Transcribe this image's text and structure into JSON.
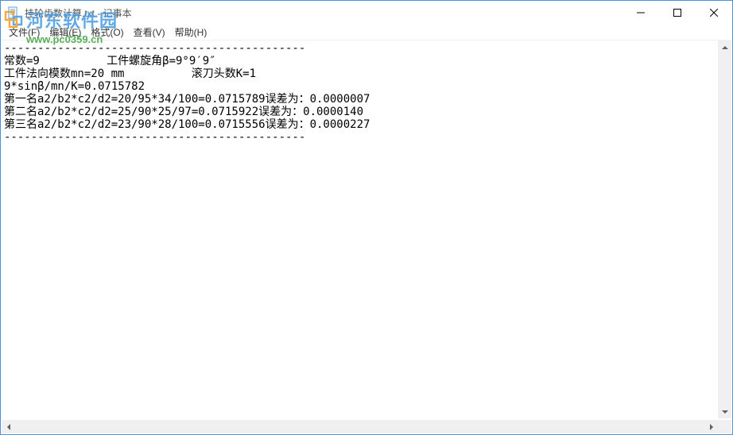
{
  "window": {
    "title": "挂轮齿数计算.txt - 记事本"
  },
  "menu": {
    "file": "文件(F)",
    "edit": "编辑(E)",
    "format": "格式(O)",
    "view": "查看(V)",
    "help": "帮助(H)"
  },
  "controls": {
    "minimize": "—",
    "maximize": "☐",
    "close": "✕"
  },
  "document": {
    "text": "---------------------------------------------\n常数=9          工件螺旋角β=9°9′9″\n工件法向模数mn=20 mm          滚刀头数K=1\n9*sinβ/mn/K=0.0715782\n第一名a2/b2*c2/d2=20/95*34/100=0.0715789误差为：0.0000007\n第二名a2/b2*c2/d2=25/90*25/97=0.0715922误差为：0.0000140\n第三名a2/b2*c2/d2=23/90*28/100=0.0715556误差为：0.0000227\n---------------------------------------------"
  },
  "watermark": {
    "brand": "河东软件园",
    "url": "www.pc0359.cn"
  },
  "scroll": {
    "up": "▲",
    "down": "▼",
    "left": "◀",
    "right": "▶"
  }
}
